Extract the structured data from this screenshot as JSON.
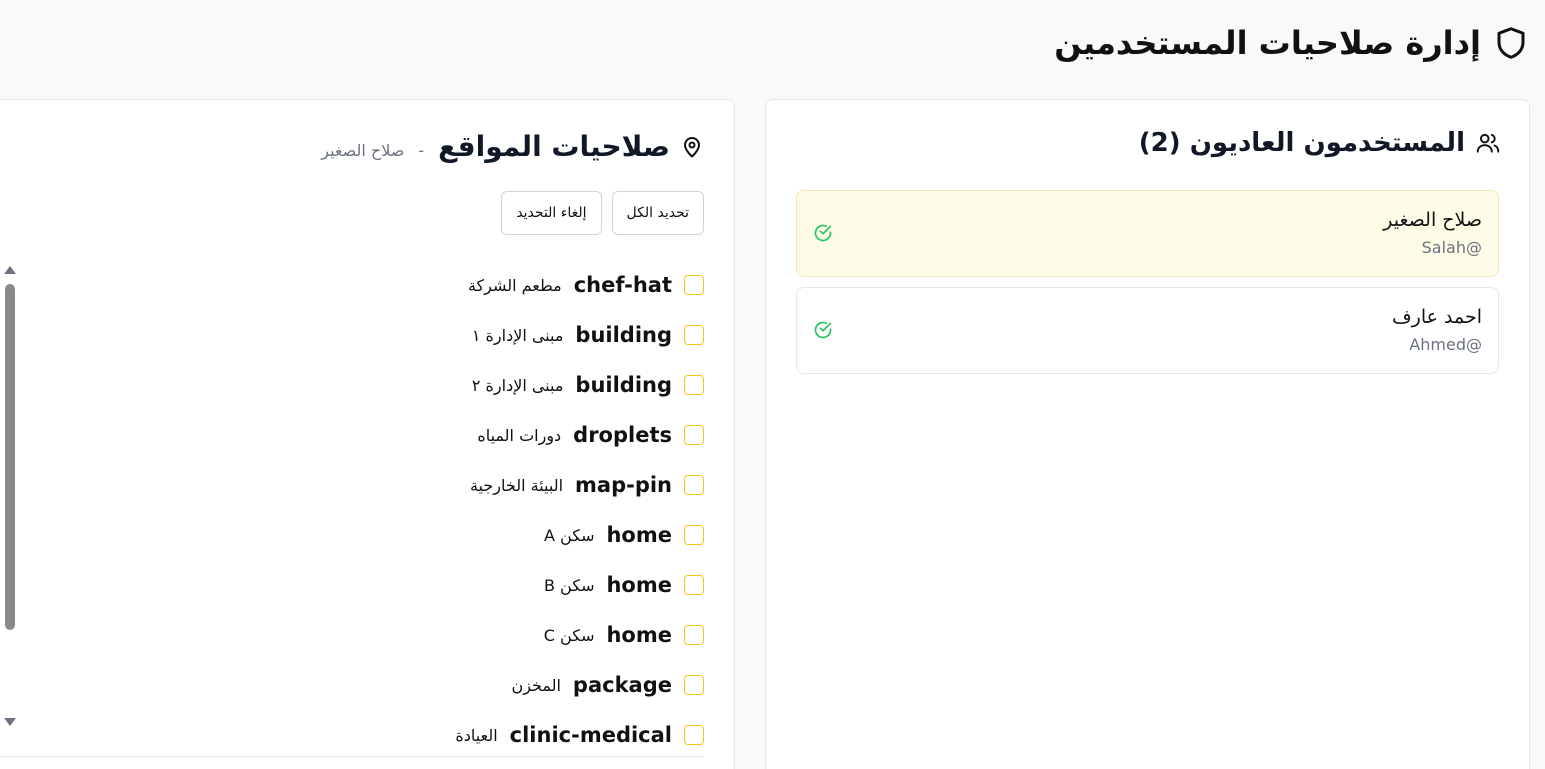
{
  "header": {
    "title": "إدارة صلاحيات المستخدمين",
    "icon": "shield-icon"
  },
  "users_panel": {
    "title": "المستخدمون العاديون (2)",
    "icon": "users-icon",
    "users": [
      {
        "name": "صلاح الصغير",
        "handle": "Salah@",
        "selected": true,
        "status_icon": "check-circle-icon"
      },
      {
        "name": "احمد عارف",
        "handle": "Ahmed@",
        "selected": false,
        "status_icon": "check-circle-icon"
      }
    ]
  },
  "permissions_panel": {
    "title": "صلاحيات المواقع",
    "icon": "map-pin-icon",
    "separator": "-",
    "subtitle": "صلاح الصغير",
    "select_all_label": "تحديد الكل",
    "deselect_label": "إلغاء التحديد",
    "locations": [
      {
        "icon": "chef-hat",
        "label": "مطعم الشركة",
        "checked": false
      },
      {
        "icon": "building",
        "label": "مبنى الإدارة ١",
        "checked": false
      },
      {
        "icon": "building",
        "label": "مبنى الإدارة ٢",
        "checked": false
      },
      {
        "icon": "droplets",
        "label": "دورات المياه",
        "checked": false
      },
      {
        "icon": "map-pin",
        "label": "البيئة الخارجية",
        "checked": false
      },
      {
        "icon": "home",
        "label": "سكن A",
        "checked": false
      },
      {
        "icon": "home",
        "label": "سكن B",
        "checked": false
      },
      {
        "icon": "home",
        "label": "سكن C",
        "checked": false
      },
      {
        "icon": "package",
        "label": "المخزن",
        "checked": false
      },
      {
        "icon": "clinic-medical",
        "label": "العيادة",
        "checked": false
      }
    ]
  },
  "colors": {
    "accent": "#f5c518",
    "selected_row_bg": "#fefbe6",
    "check_green": "#22c55e",
    "muted_text": "#6b7280"
  }
}
